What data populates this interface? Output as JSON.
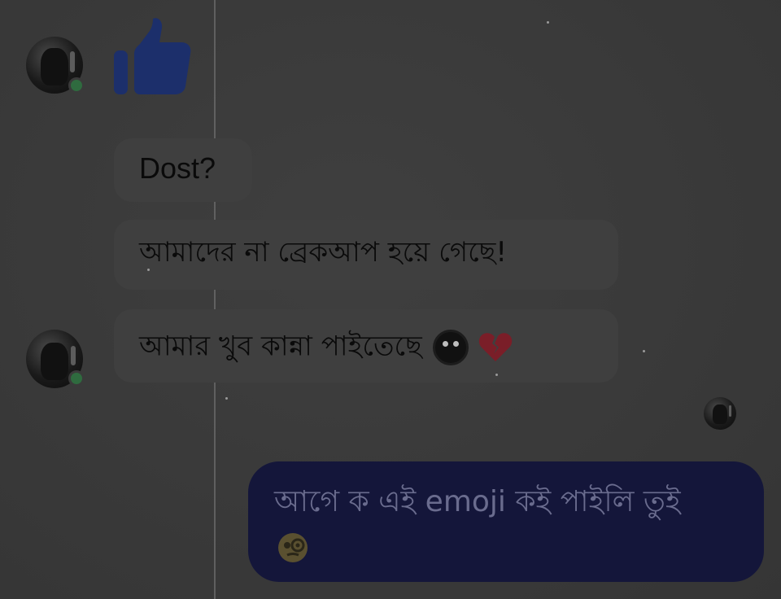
{
  "conversation": {
    "incoming": [
      {
        "type": "like",
        "icon": "thumbs-up-icon",
        "color": "#1c2f6b"
      },
      {
        "type": "text",
        "text": "Dost?"
      },
      {
        "type": "text",
        "text": "আমাদের না ব্রেকআপ হয়ে গেছে!"
      },
      {
        "type": "text",
        "text": "আমার খুব কান্না পাইতেছে",
        "emojis": [
          "dark-face-emoji-icon",
          "broken-heart-icon"
        ]
      }
    ],
    "outgoing": [
      {
        "type": "text",
        "text": "আগে ক এই emoji কই পাইলি তুই",
        "emojis": [
          "face-with-monocle-icon"
        ]
      }
    ]
  },
  "colors": {
    "background": "#3a3a3a",
    "outgoing_bubble": "#14163a",
    "outgoing_text": "#6a6c8e",
    "online_status": "#2f6b3f",
    "like_blue": "#1c2f6b",
    "broken_heart": "#7a1e28"
  }
}
